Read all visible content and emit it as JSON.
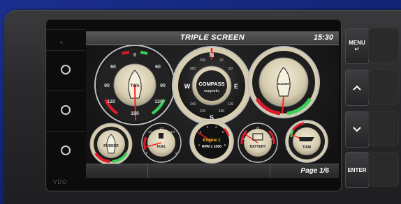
{
  "screen": {
    "title": "TRIPLE SCREEN",
    "time": "15:30",
    "page": "Page 1/6"
  },
  "brand": "VDO",
  "hardware_buttons": {
    "menu": "MENU",
    "enter": "ENTER"
  },
  "top_gauges": {
    "twa": {
      "label": "TWA",
      "ticks": [
        "0",
        "60",
        "60",
        "90",
        "90",
        "120",
        "120",
        "180"
      ]
    },
    "compass": {
      "label": "COMPASS",
      "sublabel": "magnetic",
      "cardinals": [
        "N",
        "E",
        "S",
        "W"
      ],
      "degrees": [
        "330",
        "30",
        "300",
        "60",
        "240",
        "120",
        "210",
        "150"
      ]
    },
    "rudder": {
      "label": "RUDDER"
    }
  },
  "bottom_gauges": {
    "rudder": {
      "label": "RUDDER"
    },
    "fuel": {
      "label": "FUEL",
      "ticks": [
        "1/2",
        "1/4",
        "3/4",
        "0",
        "1"
      ]
    },
    "engine": {
      "label": "Engine 1",
      "sublabel": "RPM x 1000",
      "ticks": [
        "1",
        "2",
        "3",
        "4",
        "5",
        "6"
      ]
    },
    "battery": {
      "label": "BATTERY",
      "ticks": [
        "24",
        "20",
        "28"
      ]
    },
    "trim": {
      "label": "TRIM"
    }
  },
  "colors": {
    "bezel_cream": "#d8ceb4",
    "red_zone": "#e0182b",
    "green_zone": "#3bd05a",
    "needle": "#ff2020",
    "engine_text": "#f0c020"
  }
}
